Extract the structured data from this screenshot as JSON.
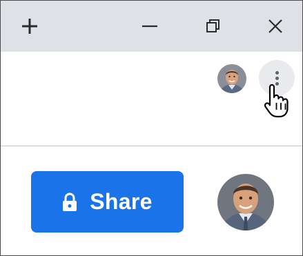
{
  "window_controls": {
    "new_tab_icon": "plus-icon",
    "minimize_icon": "minimize-icon",
    "restore_icon": "restore-icon",
    "close_icon": "close-icon"
  },
  "toolbar": {
    "profile_avatar": "profile-photo",
    "menu_icon": "three-dot-vertical-icon",
    "cursor_icon": "hand-pointer-cursor"
  },
  "content": {
    "share_button": {
      "icon": "lock-icon",
      "label": "Share"
    },
    "profile_avatar": "profile-photo"
  },
  "colors": {
    "titlebar": "#dee1e6",
    "accent": "#1a73e8",
    "menu_hover": "#e8eaed",
    "icon": "#5f6368"
  }
}
